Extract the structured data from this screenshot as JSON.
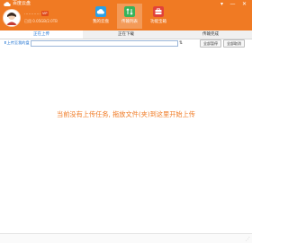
{
  "app": {
    "title": "百度云盘",
    "window_controls": {
      "skin": "▾",
      "minimize": "—",
      "close": "✕"
    }
  },
  "user": {
    "name_line": "…………",
    "vip_badge": "VIP",
    "quota_line": "已用 0.05GB/2.0TB"
  },
  "nav": {
    "items": [
      {
        "label": "我的云盘",
        "icon": "cloud-icon",
        "color": "#2aa0e6"
      },
      {
        "label": "传输列表",
        "icon": "transfer-icon",
        "color": "#36b35a"
      },
      {
        "label": "功能宝箱",
        "icon": "toolbox-icon",
        "color": "#e2423a"
      }
    ],
    "active_index": 1
  },
  "tabs": {
    "items": [
      "正在上传",
      "正在下载",
      "传输完成"
    ],
    "active_index": 0
  },
  "toolbar": {
    "path_label": "上传至我的盘",
    "path_value": "",
    "pause_all": "全部暂停",
    "delete_all": "全部取消"
  },
  "main": {
    "empty_message": "当前没有上传任务, 拖放文件(夹)到这里开始上传"
  },
  "colors": {
    "brand": "#f07a23",
    "tab_active_text": "#1a6fd0"
  }
}
